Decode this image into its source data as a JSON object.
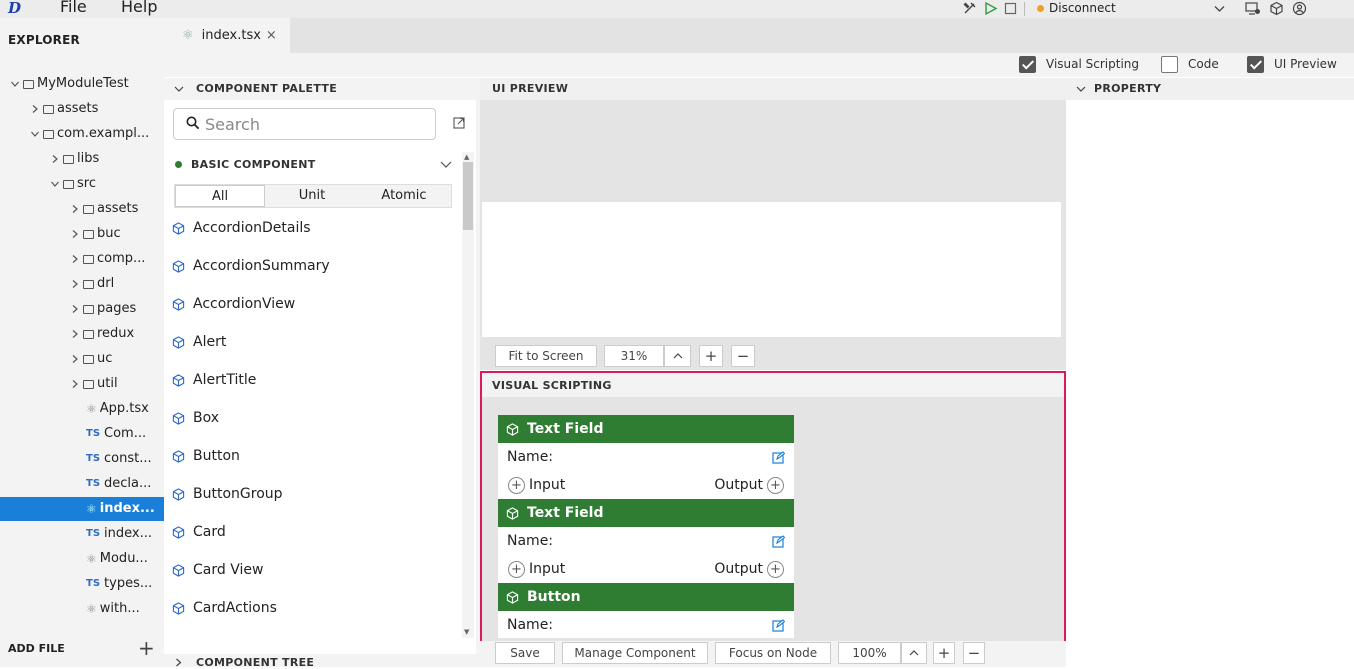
{
  "menubar": {
    "file_label": "File",
    "help_label": "Help",
    "status_label": "Disconnect"
  },
  "explorer": {
    "title": "EXPLORER",
    "tree": [
      {
        "label": "MyModuleTest",
        "kind": "folder",
        "expanded": true,
        "depth": 0
      },
      {
        "label": "assets",
        "kind": "folder",
        "expanded": false,
        "depth": 1
      },
      {
        "label": "com.exampl...",
        "kind": "folder",
        "expanded": true,
        "depth": 1
      },
      {
        "label": "libs",
        "kind": "folder",
        "expanded": false,
        "depth": 2
      },
      {
        "label": "src",
        "kind": "folder",
        "expanded": true,
        "depth": 2
      },
      {
        "label": "assets",
        "kind": "folder",
        "expanded": false,
        "depth": 3
      },
      {
        "label": "buc",
        "kind": "folder",
        "expanded": false,
        "depth": 3
      },
      {
        "label": "comp...",
        "kind": "folder",
        "expanded": false,
        "depth": 3
      },
      {
        "label": "drl",
        "kind": "folder",
        "expanded": false,
        "depth": 3
      },
      {
        "label": "pages",
        "kind": "folder",
        "expanded": false,
        "depth": 3
      },
      {
        "label": "redux",
        "kind": "folder",
        "expanded": false,
        "depth": 3
      },
      {
        "label": "uc",
        "kind": "folder",
        "expanded": false,
        "depth": 3
      },
      {
        "label": "util",
        "kind": "folder",
        "expanded": false,
        "depth": 3
      },
      {
        "label": "App.tsx",
        "kind": "react",
        "depth": 4
      },
      {
        "label": "Com...",
        "kind": "ts",
        "depth": 4
      },
      {
        "label": "const...",
        "kind": "ts",
        "depth": 4
      },
      {
        "label": "decla...",
        "kind": "ts",
        "depth": 4
      },
      {
        "label": "index...",
        "kind": "react",
        "depth": 4,
        "selected": true
      },
      {
        "label": "index...",
        "kind": "ts",
        "depth": 4
      },
      {
        "label": "Modu...",
        "kind": "react",
        "depth": 4
      },
      {
        "label": "types...",
        "kind": "ts",
        "depth": 4
      },
      {
        "label": "with...",
        "kind": "react",
        "depth": 4
      }
    ],
    "ts_badge": "TS",
    "add_file_label": "ADD FILE",
    "add_file_plus": "+"
  },
  "editor": {
    "tab_label": "index.tsx",
    "tab_close": "×"
  },
  "toggles": [
    {
      "label": "Visual Scripting",
      "checked": true
    },
    {
      "label": "Code",
      "checked": false
    },
    {
      "label": "UI Preview",
      "checked": true
    }
  ],
  "palette": {
    "title": "COMPONENT PALETTE",
    "search_placeholder": "Search",
    "section_title": "BASIC COMPONENT",
    "filters": [
      "All",
      "Unit",
      "Atomic"
    ],
    "items": [
      "AccordionDetails",
      "AccordionSummary",
      "AccordionView",
      "Alert",
      "AlertTitle",
      "Box",
      "Button",
      "ButtonGroup",
      "Card",
      "Card View",
      "CardActions"
    ],
    "component_tree_title": "COMPONENT TREE"
  },
  "preview": {
    "title": "UI PREVIEW",
    "fit_label": "Fit to Screen",
    "zoom": "31%",
    "plus": "+",
    "minus": "−"
  },
  "visual_scripting": {
    "title": "VISUAL SCRIPTING",
    "nodes": [
      {
        "title": "Text Field",
        "name_label": "Name:",
        "input_label": "Input",
        "output_label": "Output"
      },
      {
        "title": "Text Field",
        "name_label": "Name:",
        "input_label": "Input",
        "output_label": "Output"
      },
      {
        "title": "Button",
        "name_label": "Name:"
      }
    ],
    "save_label": "Save",
    "manage_label": "Manage Component",
    "focus_label": "Focus on Node",
    "zoom": "100%",
    "plus": "+",
    "minus": "−"
  },
  "property": {
    "title": "PROPERTY"
  },
  "colors": {
    "accent": "#1a7fd9",
    "node_header": "#2e7d32",
    "highlight_border": "#d81b60",
    "status_dot": "#f0a020"
  }
}
